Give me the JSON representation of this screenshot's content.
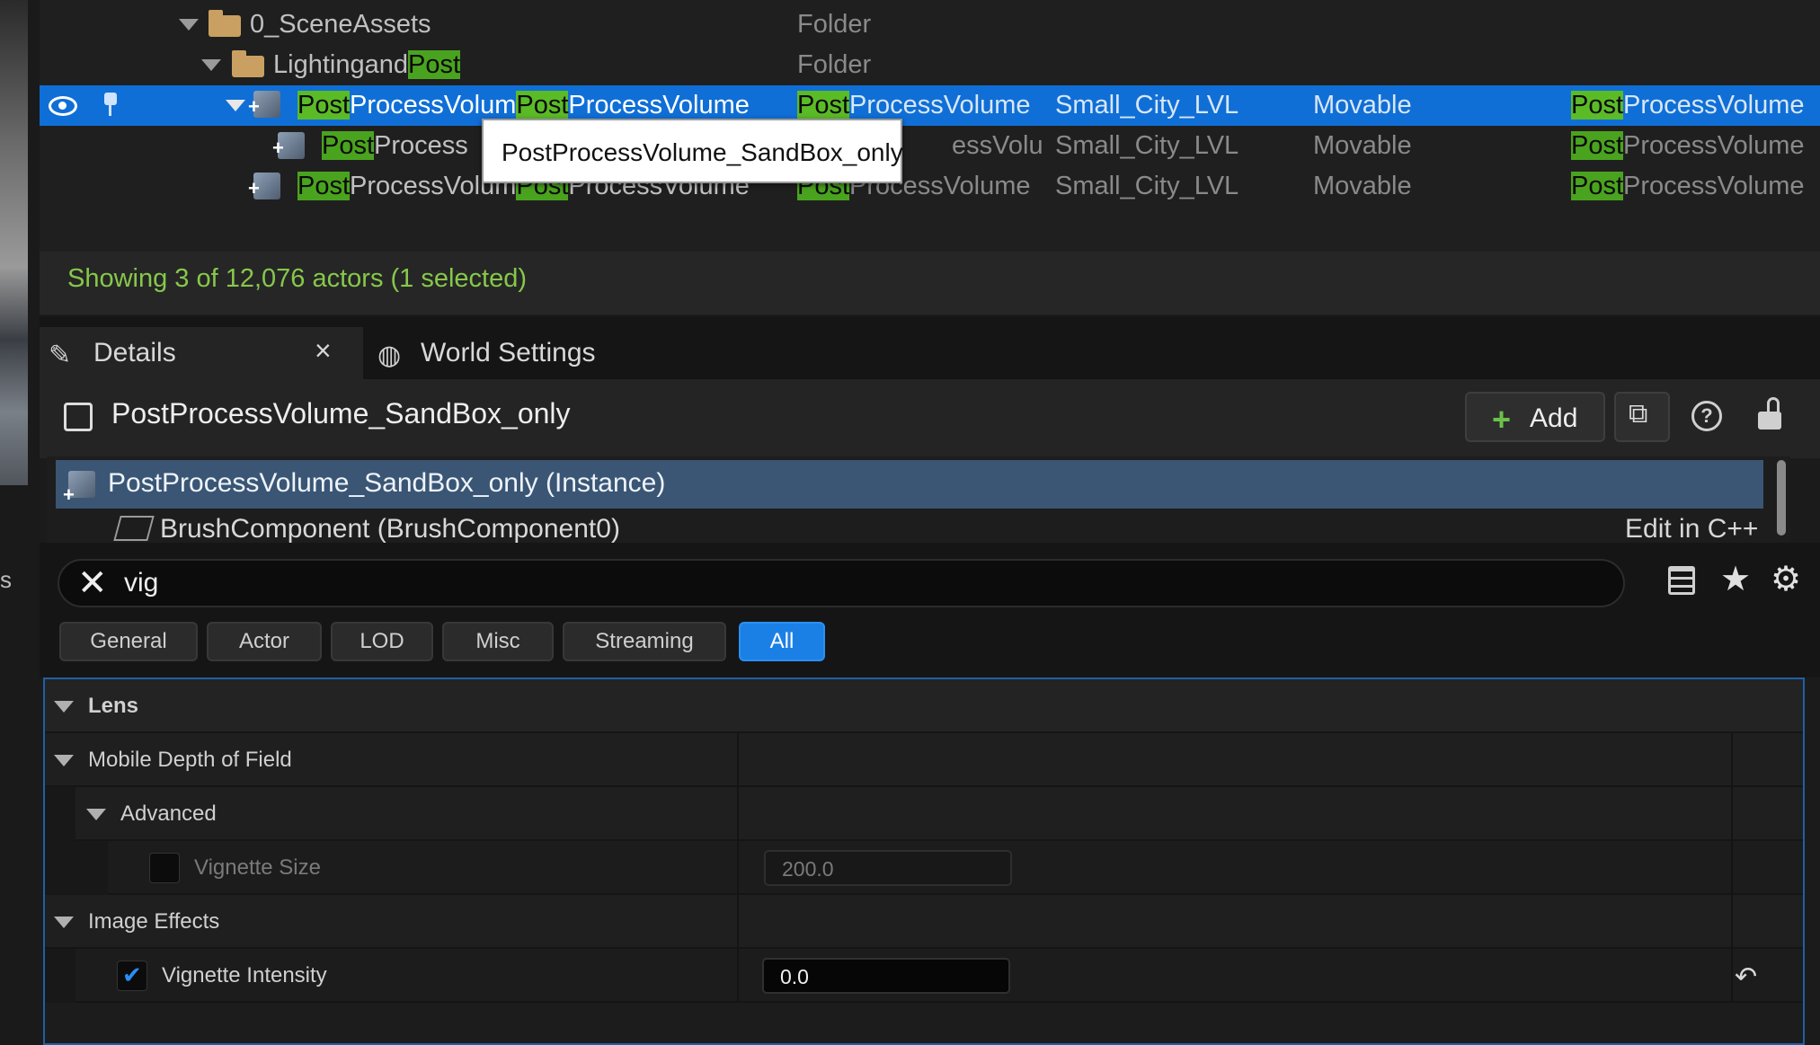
{
  "outliner": {
    "rows": [
      {
        "name": "0_SceneAssets",
        "type": "Folder"
      },
      {
        "name": "LightingandPost",
        "name_pre": "Lightingand",
        "name_hl": "Post",
        "type": "Folder"
      },
      {
        "name_hl": "Post",
        "name_a": "ProcessVolum",
        "name_hl2": "Post",
        "name_b": "ProcessVolume",
        "type_hl": "Post",
        "type_rest": "ProcessVolume",
        "level": "Small_City_LVL",
        "mobility": "Movable",
        "class_hl": "Post",
        "class_rest": "ProcessVolume"
      },
      {
        "name_hl": "Post",
        "name_a": "Process",
        "type_rest": "essVolume",
        "level": "Small_City_LVL",
        "mobility": "Movable",
        "class_hl": "Post",
        "class_rest": "ProcessVolume"
      },
      {
        "name_hl": "Post",
        "name_a": "ProcessVolum",
        "name_hl2": "Post",
        "name_b": "ProcessVolume",
        "type_hl": "Post",
        "type_rest": "ProcessVolume",
        "level": "Small_City_LVL",
        "mobility": "Movable",
        "class_hl": "Post",
        "class_rest": "ProcessVolume"
      }
    ],
    "status": "Showing 3 of 12,076 actors (1 selected)"
  },
  "tooltip": "PostProcessVolume_SandBox_only",
  "tabs": {
    "details": "Details",
    "close": "×",
    "world": "World Settings"
  },
  "details": {
    "actor_name": "PostProcessVolume_SandBox_only",
    "add_label": "Add",
    "components": {
      "instance": "PostProcessVolume_SandBox_only (Instance)",
      "brush": "BrushComponent (BrushComponent0)",
      "edit": "Edit in C++"
    },
    "search": {
      "value": "vig"
    },
    "filters": [
      "General",
      "Actor",
      "LOD",
      "Misc",
      "Streaming",
      "All"
    ],
    "active_filter": "All",
    "sections": {
      "lens": "Lens",
      "mobile_dof": "Mobile Depth of Field",
      "advanced": "Advanced",
      "vignette_size_label": "Vignette Size",
      "vignette_size_value": "200.0",
      "image_effects": "Image Effects",
      "vignette_intensity_label": "Vignette Intensity",
      "vignette_intensity_value": "0.0"
    }
  },
  "colors": {
    "selection": "#0f6fd6",
    "highlight": "#4aa31f",
    "status": "#86c84a",
    "accent": "#1a80e6"
  }
}
